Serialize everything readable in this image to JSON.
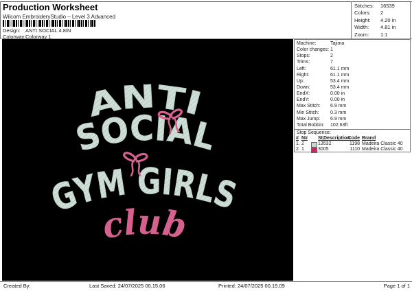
{
  "header": {
    "title": "Production Worksheet",
    "subtitle": "Wilcom EmbroideryStudio – Level 3 Advanced",
    "design_label": "Design:",
    "design_value": "ANTI SOCIAL 4.8IN",
    "colorway_label": "Colorway:",
    "colorway_value": "Colorway 1"
  },
  "summary": {
    "rows": [
      {
        "label": "Stitches:",
        "value": "16539"
      },
      {
        "label": "Colors:",
        "value": "2"
      },
      {
        "label": "Height:",
        "value": "4.20 in"
      },
      {
        "label": "Width:",
        "value": "4.81 in"
      },
      {
        "label": "Zoom:",
        "value": "1:1"
      }
    ]
  },
  "machine_info": {
    "rows": [
      {
        "label": "Machine:",
        "value": "Tajima"
      },
      {
        "label": "Color changes:",
        "value": "1"
      },
      {
        "label": "Stops:",
        "value": "2"
      },
      {
        "label": "Trims:",
        "value": "7"
      },
      {
        "label": "Left:",
        "value": "61.1 mm"
      },
      {
        "label": "Right:",
        "value": "61.1 mm"
      },
      {
        "label": "Up:",
        "value": "53.4 mm"
      },
      {
        "label": "Down:",
        "value": "53.4 mm"
      },
      {
        "label": "EndX:",
        "value": "0.00 in"
      },
      {
        "label": "EndY:",
        "value": "0.00 in"
      },
      {
        "label": "Max Stitch:",
        "value": "6.9 mm"
      },
      {
        "label": "Min Stitch:",
        "value": "0.3 mm"
      },
      {
        "label": "Max Jump:",
        "value": "6.9 mm"
      },
      {
        "label": "Total Bobbin:",
        "value": "102.63ft"
      }
    ]
  },
  "stop_sequence": {
    "title": "Stop Sequence:",
    "columns": {
      "num": "#",
      "n": "N#",
      "st": "St.",
      "description": "Description",
      "code": "Code",
      "brand": "Brand"
    },
    "rows": [
      {
        "num": "1.",
        "n": "2",
        "swatch": "#c9d6ce",
        "st": "13532",
        "description": "",
        "code": "1198",
        "brand": "Madeira Classic 40"
      },
      {
        "num": "2.",
        "n": "1",
        "swatch": "#c42a64",
        "st": "3005",
        "description": "",
        "code": "1110",
        "brand": "Madeira Classic 40"
      }
    ]
  },
  "design": {
    "line1": "ANTI",
    "line2": "SOCIAL",
    "line3": "GYM GIRLS",
    "line4": "club",
    "background": "#000000",
    "thread_color": "#cfded6",
    "thread_shade": "#b7c9c0",
    "accent_color": "#d7618e"
  },
  "footer": {
    "created_by": "Created By:",
    "last_saved": "Last Saved: 24/07/2025 00.15.06",
    "printed": "Printed: 24/07/2025 00.15.09",
    "page": "Page 1 of 1"
  }
}
